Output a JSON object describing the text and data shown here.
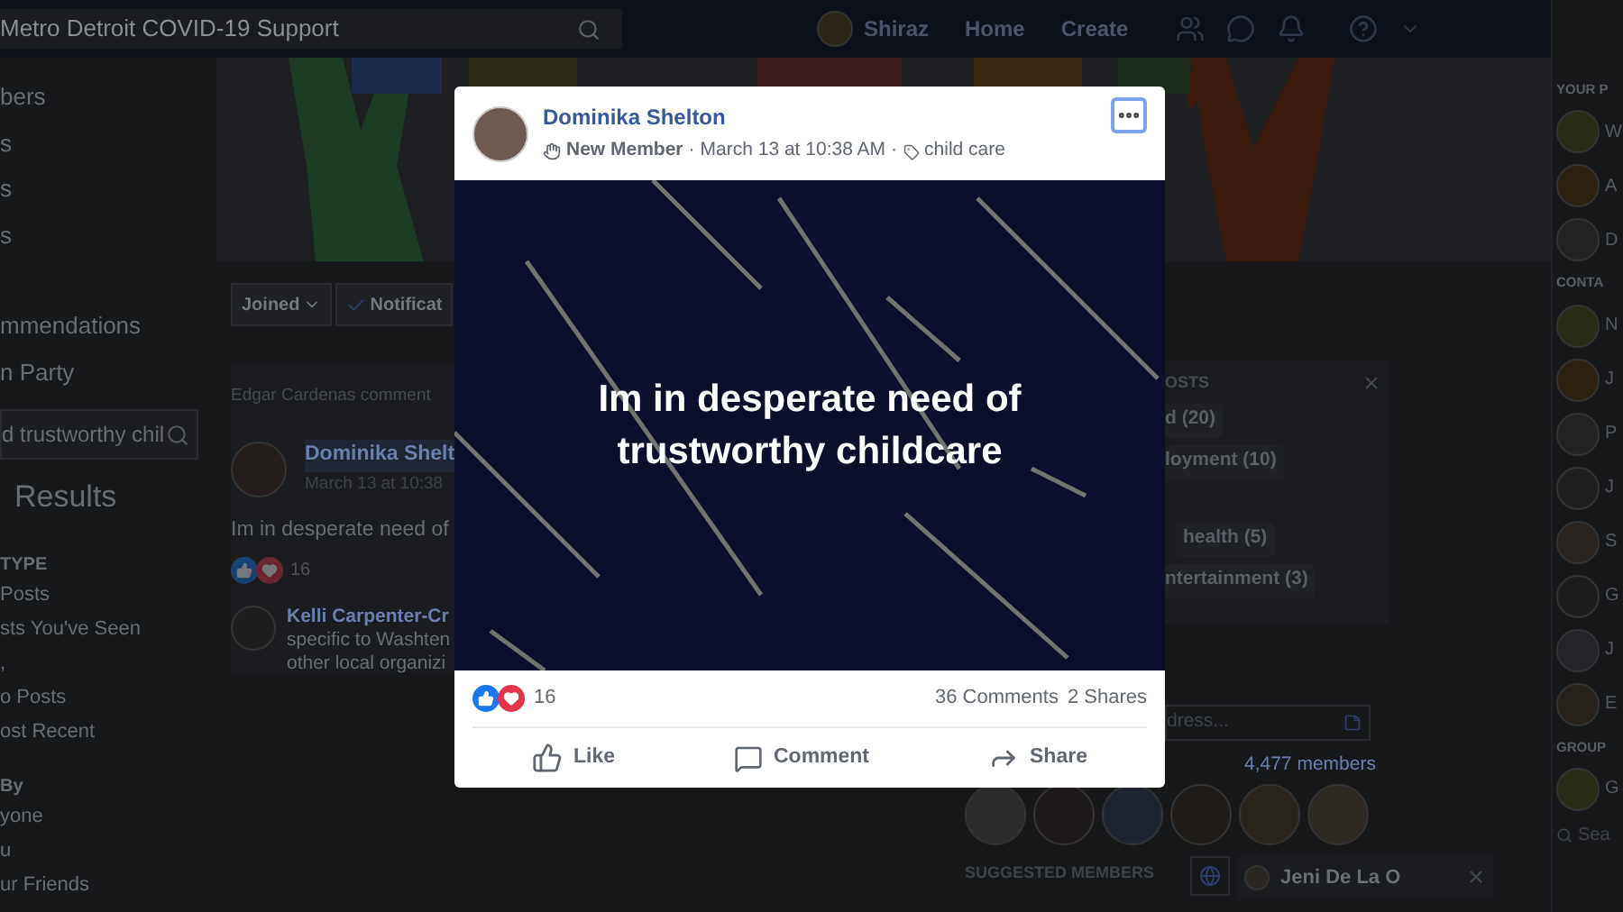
{
  "top_bar": {
    "search_value": "Metro Detroit COVID-19 Support",
    "user_name": "Shiraz",
    "nav": [
      "Home",
      "Create"
    ]
  },
  "left_sidebar": {
    "items": [
      {
        "kind": "link",
        "label": "bers"
      },
      {
        "kind": "link",
        "label": "s"
      },
      {
        "kind": "link",
        "label": "s"
      },
      {
        "kind": "link",
        "label": "s"
      },
      {
        "kind": "gap"
      },
      {
        "kind": "link",
        "label": "mmendations"
      },
      {
        "kind": "link",
        "label": "n Party"
      },
      {
        "kind": "search",
        "label": "d trustworthy chil"
      },
      {
        "kind": "title",
        "label": "Results"
      },
      {
        "kind": "heading",
        "label": "TYPE"
      },
      {
        "kind": "option",
        "label": "Posts"
      },
      {
        "kind": "option",
        "label": "sts You've Seen"
      },
      {
        "kind": "option",
        "label": ","
      },
      {
        "kind": "option",
        "label": "o Posts"
      },
      {
        "kind": "option",
        "label": "ost Recent"
      },
      {
        "kind": "heading",
        "label": "By"
      },
      {
        "kind": "option",
        "label": "yone"
      },
      {
        "kind": "option",
        "label": "u"
      },
      {
        "kind": "option",
        "label": "ur Friends"
      }
    ]
  },
  "group": {
    "buttons": [
      {
        "kind": "dropdown",
        "label": "Joined"
      },
      {
        "kind": "checked",
        "label": "Notificat"
      }
    ],
    "activity": "Edgar Cardenas comment",
    "post": {
      "author": "Dominika Shelt",
      "time": "March 13 at 10:38",
      "text": "Im in desperate need of",
      "reaction_count": "16"
    },
    "comment": {
      "author": "Kelli Carpenter-Cr",
      "lines": [
        "specific to Washten",
        "other local organizi"
      ]
    }
  },
  "right_panel": {
    "tags_header": "OSTS",
    "tags": [
      {
        "label": "d (20)"
      },
      {
        "label": "loyment (10)"
      },
      {
        "label": "health (5)"
      },
      {
        "label": "ntertainment (3)"
      }
    ],
    "address_placeholder": "dress...",
    "members_count": "4,477 members",
    "suggested_header": "SUGGESTED MEMBERS",
    "chat_name": "Jeni De La O"
  },
  "far_right": {
    "sections": [
      {
        "heading": "YOUR P",
        "items": [
          "W",
          "A",
          "D"
        ]
      },
      {
        "heading": "CONTA",
        "items": [
          "N",
          "J",
          "P",
          "J",
          "S",
          "G",
          "J",
          "E"
        ]
      },
      {
        "heading": "GROUP",
        "items": [
          "G"
        ]
      }
    ],
    "search_placeholder": "Sea"
  },
  "modal": {
    "author": "Dominika Shelton",
    "badge": "New Member",
    "separator": "·",
    "time": "March 13 at 10:38 AM",
    "topic": "child care",
    "text": "Im in desperate need of trustworthy childcare",
    "reaction_count": "16",
    "comments": "36 Comments",
    "shares": "2 Shares",
    "actions": [
      {
        "kind": "like",
        "label": "Like"
      },
      {
        "kind": "comment",
        "label": "Comment"
      },
      {
        "kind": "share",
        "label": "Share"
      }
    ]
  }
}
